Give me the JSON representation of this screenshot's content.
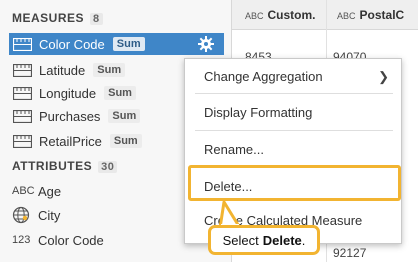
{
  "measures": {
    "header": "MEASURES",
    "count": "8",
    "items": [
      {
        "label": "Color Code",
        "agg": "Sum",
        "selected": true
      },
      {
        "label": "Latitude",
        "agg": "Sum"
      },
      {
        "label": "Longitude",
        "agg": "Sum"
      },
      {
        "label": "Purchases",
        "agg": "Sum"
      },
      {
        "label": "RetailPrice",
        "agg": "Sum"
      }
    ]
  },
  "attributes": {
    "header": "ATTRIBUTES",
    "count": "30",
    "items": [
      {
        "type": "ABC",
        "label": "Age"
      },
      {
        "type": "globe",
        "label": "City"
      },
      {
        "type": "123",
        "label": "Color Code"
      }
    ]
  },
  "grid": {
    "columns": [
      {
        "type": "ABC",
        "label": "Custom."
      },
      {
        "type": "ABC",
        "label": "PostalC"
      }
    ],
    "cells": [
      "8453",
      "94070",
      "92127"
    ]
  },
  "context_menu": {
    "items": [
      {
        "label": "Change Aggregation",
        "submenu": true
      },
      {
        "label": "Display Formatting"
      },
      {
        "label": "Rename..."
      },
      {
        "label": "Delete..."
      },
      {
        "label": "Create Calculated Measure"
      }
    ]
  },
  "callout": {
    "prefix": "Select",
    "emphasis": "Delete",
    "suffix": "."
  },
  "colors": {
    "selection": "#3f86c8",
    "highlight": "#f2b431"
  }
}
